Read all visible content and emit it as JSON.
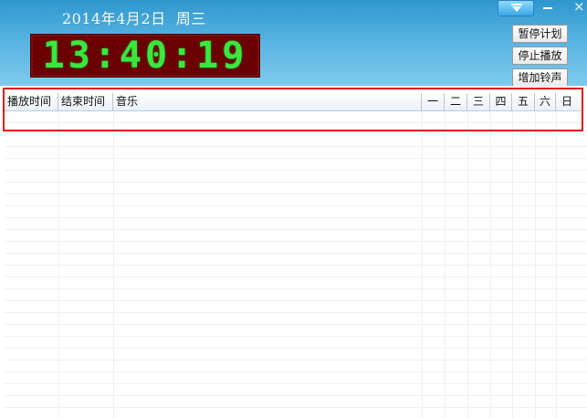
{
  "header": {
    "date": "2014年4月2日  周三",
    "clock": "13:40:19"
  },
  "title_bar": {
    "menu_icon": "dropdown-menu-icon",
    "minimize_icon": "minimize-icon",
    "close_icon": "close-icon"
  },
  "side_buttons": {
    "pause_plan": "暂停计划",
    "stop_play": "停止播放",
    "add_bell": "增加铃声"
  },
  "table": {
    "columns": [
      "播放时间",
      "结束时间",
      "音乐",
      "一",
      "二",
      "三",
      "四",
      "五",
      "六",
      "日"
    ],
    "rows": []
  },
  "colors": {
    "header_top": "#2f97ce",
    "header_bottom": "#7fcaee",
    "clock_bg": "#6b0000",
    "clock_digits": "#39e83f",
    "highlight_border": "#e0141a"
  }
}
